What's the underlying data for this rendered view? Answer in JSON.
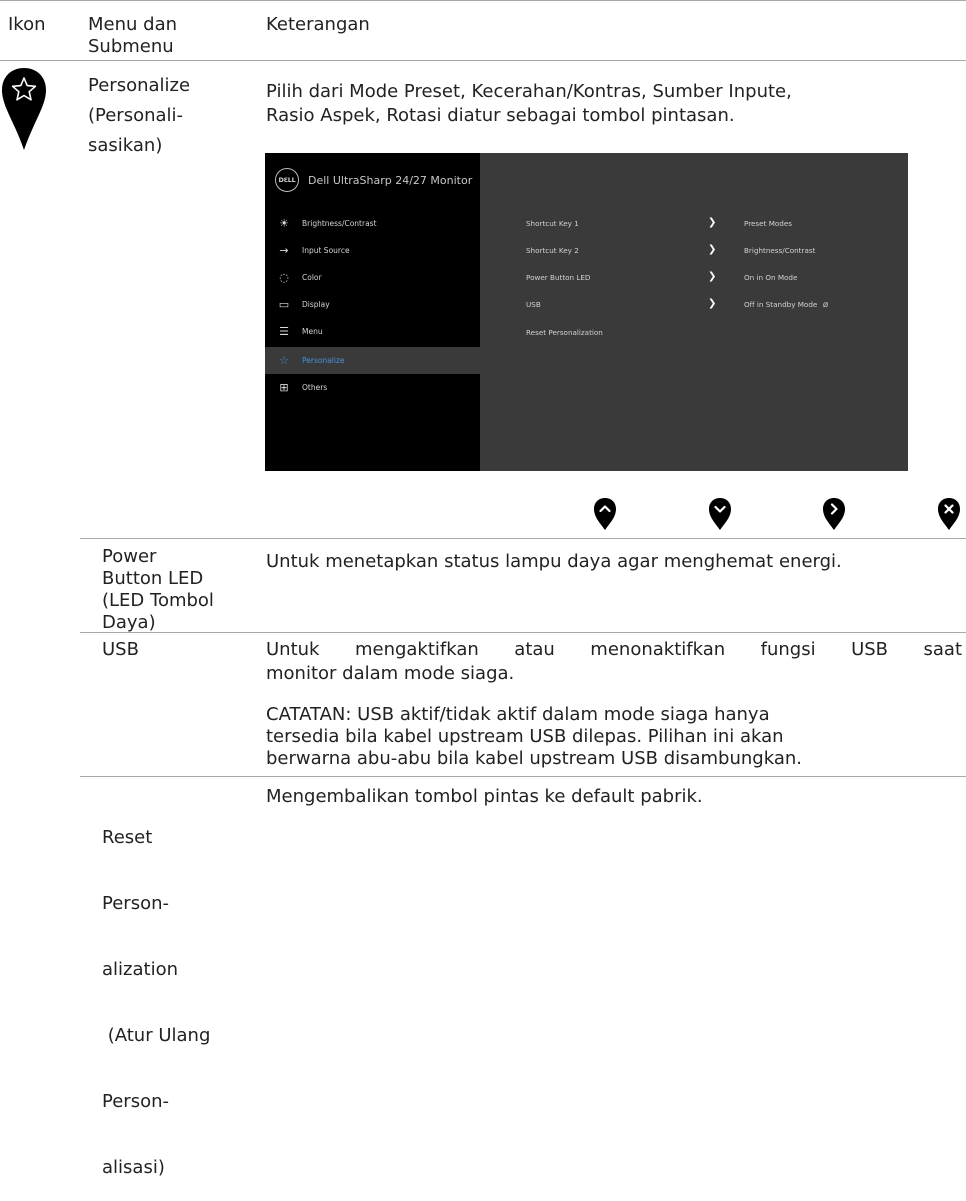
{
  "header": {
    "col1": "Ikon",
    "col2": "Menu dan Submenu",
    "col3": "Keterangan"
  },
  "personalize": {
    "name_line1": "Personalize",
    "name_line2": "(Personali-",
    "name_line3": "sasikan)",
    "desc_line1": "Pilih dari Mode Preset, Kecerahan/Kontras, Sumber Inpute,",
    "desc_line2": "Rasio Aspek, Rotasi diatur sebagai tombol pintasan.",
    "icon": "star-pin-icon"
  },
  "osd": {
    "logo": "DƐLL",
    "title": "Dell UltraSharp 24/27 Monitor",
    "menu": [
      {
        "label": "Brightness/Contrast",
        "icon": "brightness-icon",
        "glyph": "☀"
      },
      {
        "label": "Input Source",
        "icon": "input-source-icon",
        "glyph": "→"
      },
      {
        "label": "Color",
        "icon": "color-icon",
        "glyph": "◌"
      },
      {
        "label": "Display",
        "icon": "display-icon",
        "glyph": "▭"
      },
      {
        "label": "Menu",
        "icon": "menu-icon",
        "glyph": "☰"
      },
      {
        "label": "Personalize",
        "icon": "star-icon",
        "glyph": "☆"
      },
      {
        "label": "Others",
        "icon": "others-icon",
        "glyph": "⊞"
      }
    ],
    "selected_color": "#4a90d9",
    "rows": [
      {
        "label": "Shortcut Key 1",
        "value": "Preset Modes"
      },
      {
        "label": "Shortcut Key 2",
        "value": "Brightness/Contrast"
      },
      {
        "label": "Power Button LED",
        "value": "On in On Mode"
      },
      {
        "label": "USB",
        "value": "Off in Standby Mode"
      },
      {
        "label": "Reset Personalization",
        "value": ""
      }
    ]
  },
  "nav_buttons": [
    "up-button",
    "down-button",
    "right-button",
    "exit-button"
  ],
  "power_led": {
    "name_line1": "Power",
    "name_line2": "Button LED",
    "name_line3": "(LED Tombol",
    "name_line4": "Daya)",
    "desc": "Untuk menetapkan status lampu daya agar menghemat energi."
  },
  "usb": {
    "name": "USB",
    "desc_line1": "Untuk mengaktifkan atau menonaktifkan fungsi USB saat",
    "desc_line2": "monitor dalam mode siaga.",
    "note_line1": "CATATAN: USB aktif/tidak aktif dalam mode siaga hanya",
    "note_line2": "tersedia bila kabel upstream USB dilepas. Pilihan ini akan",
    "note_line3": "berwarna abu-abu bila kabel upstream USB disambungkan."
  },
  "reset": {
    "name_line1": "Reset",
    "name_line2": "Person-",
    "name_line3": "alization",
    "name_line4": " (Atur Ulang",
    "name_line5": "Person-",
    "name_line6": "alisasi)",
    "desc": "Mengembalikan tombol pintas ke default pabrik."
  }
}
